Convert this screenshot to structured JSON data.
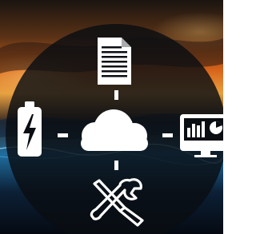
{
  "graphic": {
    "center_icon": "cloud-icon",
    "spoke_icons": [
      "document-icon",
      "battery-charging-icon",
      "dashboard-monitor-icon",
      "wrench-screwdriver-icon"
    ]
  },
  "colors": {
    "icon": "#ffffff",
    "circle_overlay": "#0a0d12",
    "sky_dark": "#1a1410",
    "sunset_orange": "#d8641a",
    "sunset_gold": "#e8a040",
    "water_blue": "#1f6ea0",
    "lightning_cyan": "#9fe0ff"
  }
}
